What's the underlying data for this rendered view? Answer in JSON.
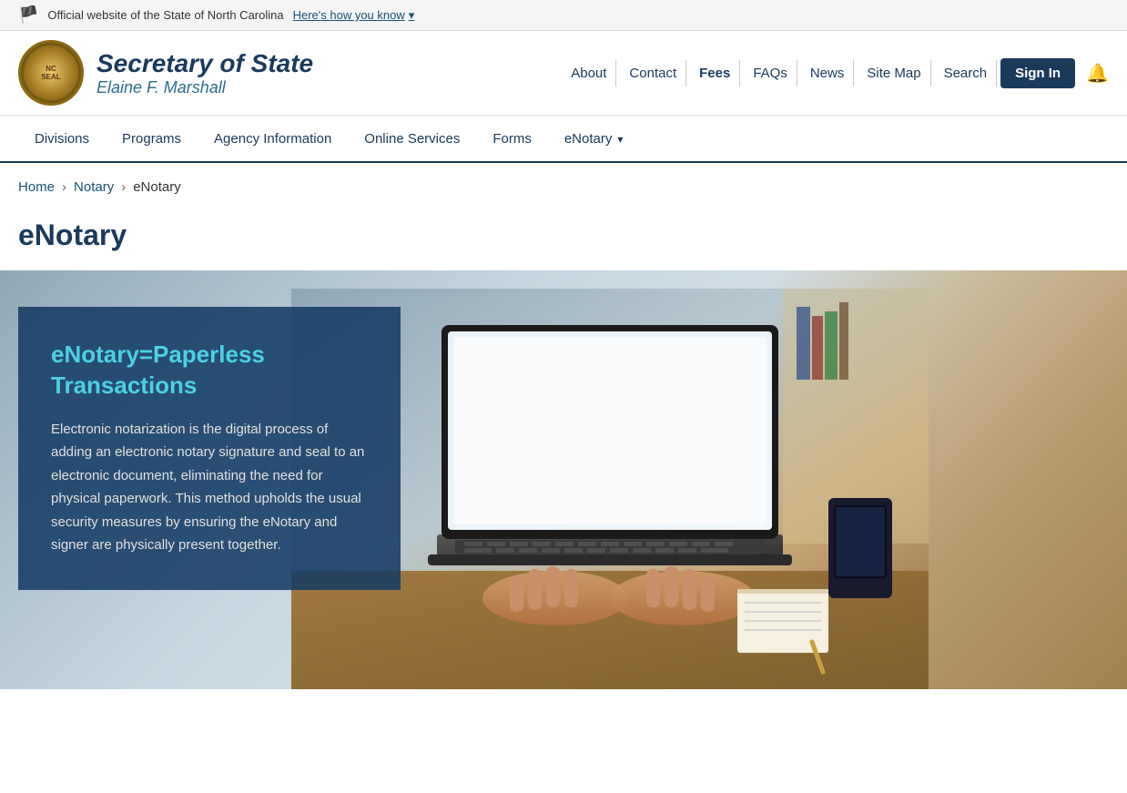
{
  "banner": {
    "flag": "🏴",
    "text": "Official website of the State of North Carolina",
    "how_you_know": "Here's how you know",
    "chevron": "▾"
  },
  "header": {
    "org_title_main": "Secretary of State",
    "org_title_sub": "Elaine F. Marshall",
    "nav": {
      "about": "About",
      "contact": "Contact",
      "fees": "Fees",
      "faqs": "FAQs",
      "news": "News",
      "site_map": "Site Map",
      "search": "Search",
      "sign_in": "Sign In"
    }
  },
  "main_nav": {
    "divisions": "Divisions",
    "programs": "Programs",
    "agency_information": "Agency Information",
    "online_services": "Online Services",
    "forms": "Forms",
    "enotary": "eNotary",
    "dropdown_arrow": "▾"
  },
  "breadcrumb": {
    "home": "Home",
    "notary": "Notary",
    "current": "eNotary",
    "sep": "›"
  },
  "page": {
    "title": "eNotary"
  },
  "hero": {
    "overlay_title": "eNotary=Paperless Transactions",
    "overlay_text": "Electronic notarization is the digital process of adding an electronic notary signature and seal to an electronic document, eliminating the need for physical paperwork. This method upholds the usual security measures by ensuring the eNotary and signer are physically present together."
  }
}
